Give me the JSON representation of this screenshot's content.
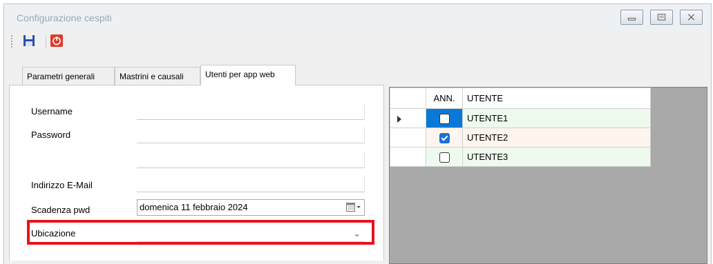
{
  "window": {
    "title": "Configurazione cespiti",
    "controls": [
      "minimize",
      "restore",
      "close"
    ]
  },
  "toolbar": {
    "save_icon": "save-icon",
    "close_icon": "power-icon"
  },
  "tabs": [
    {
      "label": "Parametri generali",
      "active": false
    },
    {
      "label": "Mastrini e causali",
      "active": false
    },
    {
      "label": "Utenti per app web",
      "active": true
    }
  ],
  "form": {
    "username_label": "Username",
    "username_value": "",
    "password_label": "Password",
    "password_value": "",
    "password_confirm_value": "",
    "email_label": "Indirizzo E-Mail",
    "email_value": "",
    "expiry_label": "Scadenza pwd",
    "expiry_value": "domenica 11  febbraio  2024",
    "location_label": "Ubicazione",
    "location_value": ""
  },
  "grid": {
    "columns": [
      "ANN.",
      "UTENTE"
    ],
    "rows": [
      {
        "ann": false,
        "utente": "UTENTE1",
        "current": true
      },
      {
        "ann": true,
        "utente": "UTENTE2",
        "current": false
      },
      {
        "ann": false,
        "utente": "UTENTE3",
        "current": false
      }
    ]
  },
  "colors": {
    "highlight": "#e8131f",
    "selection": "#0a78d7",
    "row_green": "#eefaee",
    "row_peach": "#fdf5ee"
  }
}
